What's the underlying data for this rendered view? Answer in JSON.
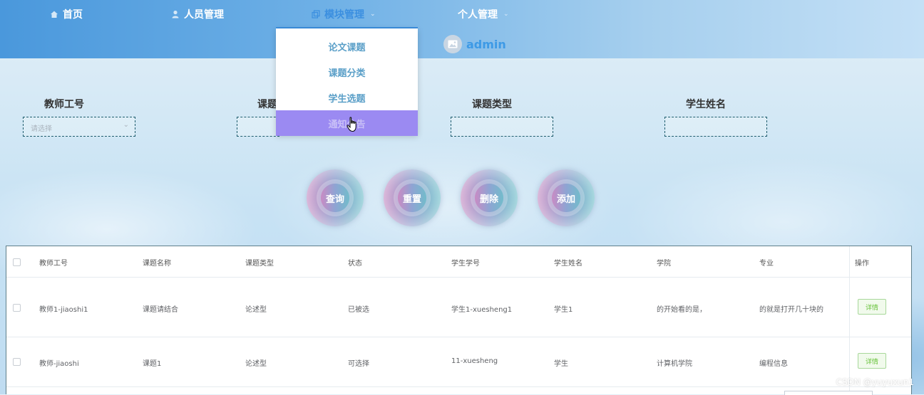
{
  "nav": {
    "items": [
      {
        "label": "首页",
        "icon": "home-icon"
      },
      {
        "label": "人员管理",
        "icon": "user-icon"
      },
      {
        "label": "模块管理",
        "icon": "module-icon"
      },
      {
        "label": "个人管理",
        "icon": ""
      }
    ],
    "active_index": 2
  },
  "user": {
    "name": "admin",
    "avatar_icon": "image-icon"
  },
  "dropdown": {
    "items": [
      "论文课题",
      "课题分类",
      "学生选题",
      "通知公告"
    ],
    "hover_index": 3
  },
  "filters": [
    {
      "label": "教师工号",
      "placeholder": "请选择"
    },
    {
      "label": "课题",
      "placeholder": ""
    },
    {
      "label": "课题类型",
      "placeholder": ""
    },
    {
      "label": "学生姓名",
      "placeholder": ""
    }
  ],
  "actions": [
    "查询",
    "重置",
    "删除",
    "添加"
  ],
  "table": {
    "headers": [
      "教师工号",
      "课题名称",
      "课题类型",
      "状态",
      "学生学号",
      "学生姓名",
      "学院",
      "专业",
      "操作"
    ],
    "rows": [
      [
        "教师1-jiaoshi1",
        "课题请结合",
        "论述型",
        "已被选",
        "学生1-xuesheng1",
        "学生1",
        "的开始看的是，",
        "的就是打开几十块的"
      ],
      [
        "教师-jiaoshi",
        "课题1",
        "论述型",
        "可选择",
        "11-xuesheng",
        "学生",
        "计算机学院",
        "编程信息"
      ]
    ],
    "detail_label": "详情"
  },
  "watermark": "CSDN @yuyuxun1",
  "colors": {
    "nav_active": "#3b8fe0",
    "dropdown_hover": "#9b8af2",
    "detail_green": "#67c23a"
  }
}
